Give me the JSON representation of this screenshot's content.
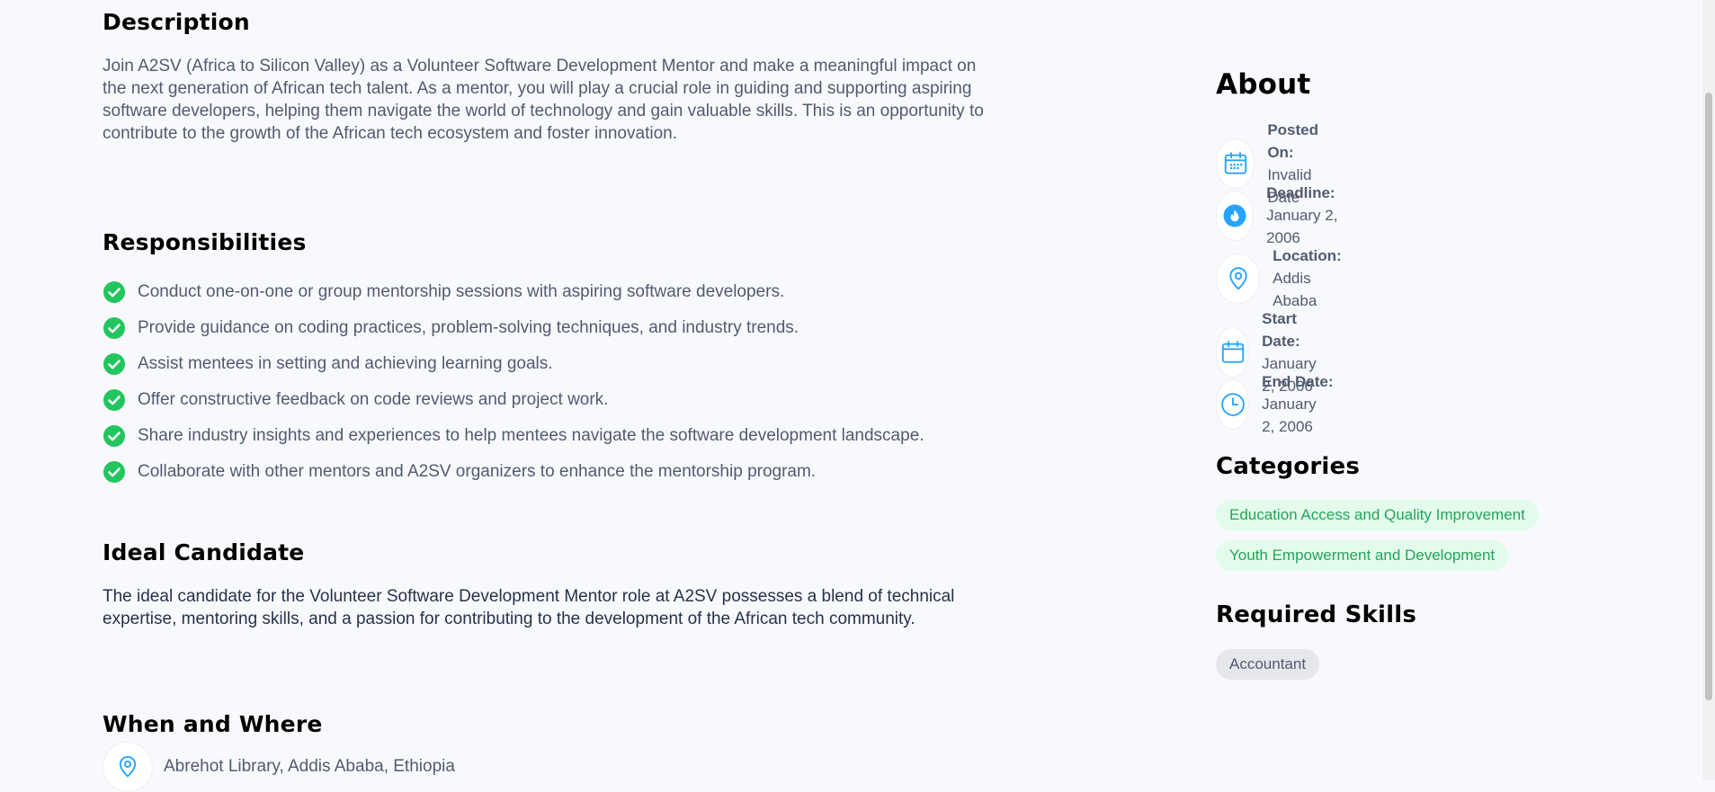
{
  "description": {
    "title": "Description",
    "text": "Join A2SV (Africa to Silicon Valley) as a Volunteer Software Development Mentor and make a meaningful impact on the next generation of African tech talent. As a mentor, you will play a crucial role in guiding and supporting aspiring software developers, helping them navigate the world of technology and gain valuable skills. This is an opportunity to contribute to the growth of the African tech ecosystem and foster innovation."
  },
  "responsibilities": {
    "title": "Responsibilities",
    "items": [
      "Conduct one-on-one or group mentorship sessions with aspiring software developers.",
      "Provide guidance on coding practices, problem-solving techniques, and industry trends.",
      "Assist mentees in setting and achieving learning goals.",
      "Offer constructive feedback on code reviews and project work.",
      "Share industry insights and experiences to help mentees navigate the software development landscape.",
      "Collaborate with other mentors and A2SV organizers to enhance the mentorship program."
    ]
  },
  "ideal_candidate": {
    "title": "Ideal Candidate",
    "text": "The ideal candidate for the Volunteer Software Development Mentor role at A2SV possesses a blend of technical expertise, mentoring skills, and a passion for contributing to the development of the African tech community."
  },
  "when_where": {
    "title": "When and Where",
    "location": "Abrehot Library, Addis Ababa, Ethiopia",
    "icon": "location-pin-icon"
  },
  "about": {
    "title": "About",
    "items": [
      {
        "label": "Posted On:",
        "value": "Invalid Date",
        "icon": "calendar-plus-icon"
      },
      {
        "label": "Deadline:",
        "value": "January 2, 2006",
        "icon": "fire-icon"
      },
      {
        "label": "Location:",
        "value": "Addis Ababa",
        "icon": "location-pin-icon"
      },
      {
        "label": "Start Date:",
        "value": "January 2, 2006",
        "icon": "calendar-icon"
      },
      {
        "label": "End Date:",
        "value": "January 2, 2006",
        "icon": "clock-icon"
      }
    ]
  },
  "categories": {
    "title": "Categories",
    "items": [
      "Education Access and Quality Improvement",
      "Youth Empowerment and Development"
    ]
  },
  "skills": {
    "title": "Required Skills",
    "items": [
      "Accountant"
    ]
  },
  "colors": {
    "accent_blue": "#26a4ff",
    "check_green": "#56cdad",
    "chip_green_bg": "#e3fbea",
    "chip_green_text": "#22a55a"
  }
}
